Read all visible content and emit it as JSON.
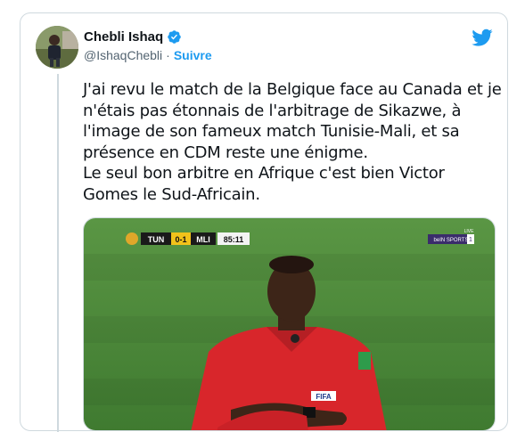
{
  "author": {
    "name": "Chebli Ishaq",
    "handle": "@IshaqChebli",
    "separator": "·",
    "follow_label": "Suivre"
  },
  "tweet": {
    "lines": [
      "J'ai revu le match de la Belgique face au Canada et je n'étais pas étonnais de l'arbitrage de Sikazwe, à l'image de son fameux match Tunisie-Mali, et sa présence en CDM reste une énigme.",
      "Le seul bon arbitre en Afrique c'est bien Victor Gomes le Sud-Africain."
    ]
  },
  "media": {
    "scoreboard": {
      "team_home": "TUN",
      "score": "0-1",
      "team_away": "MLI",
      "clock": "85:11"
    },
    "broadcaster": "beIN SPORTS",
    "channel": "1",
    "live_label": "LIVE",
    "badge_text": "FIFA"
  },
  "colors": {
    "accent": "#1d9bf0",
    "text": "#0f1419",
    "muted": "#536471",
    "border": "#cfd9de",
    "pitch": "#4e8a3a"
  },
  "icons": {
    "verified": "verified-badge-icon",
    "twitter": "twitter-bird-icon"
  }
}
